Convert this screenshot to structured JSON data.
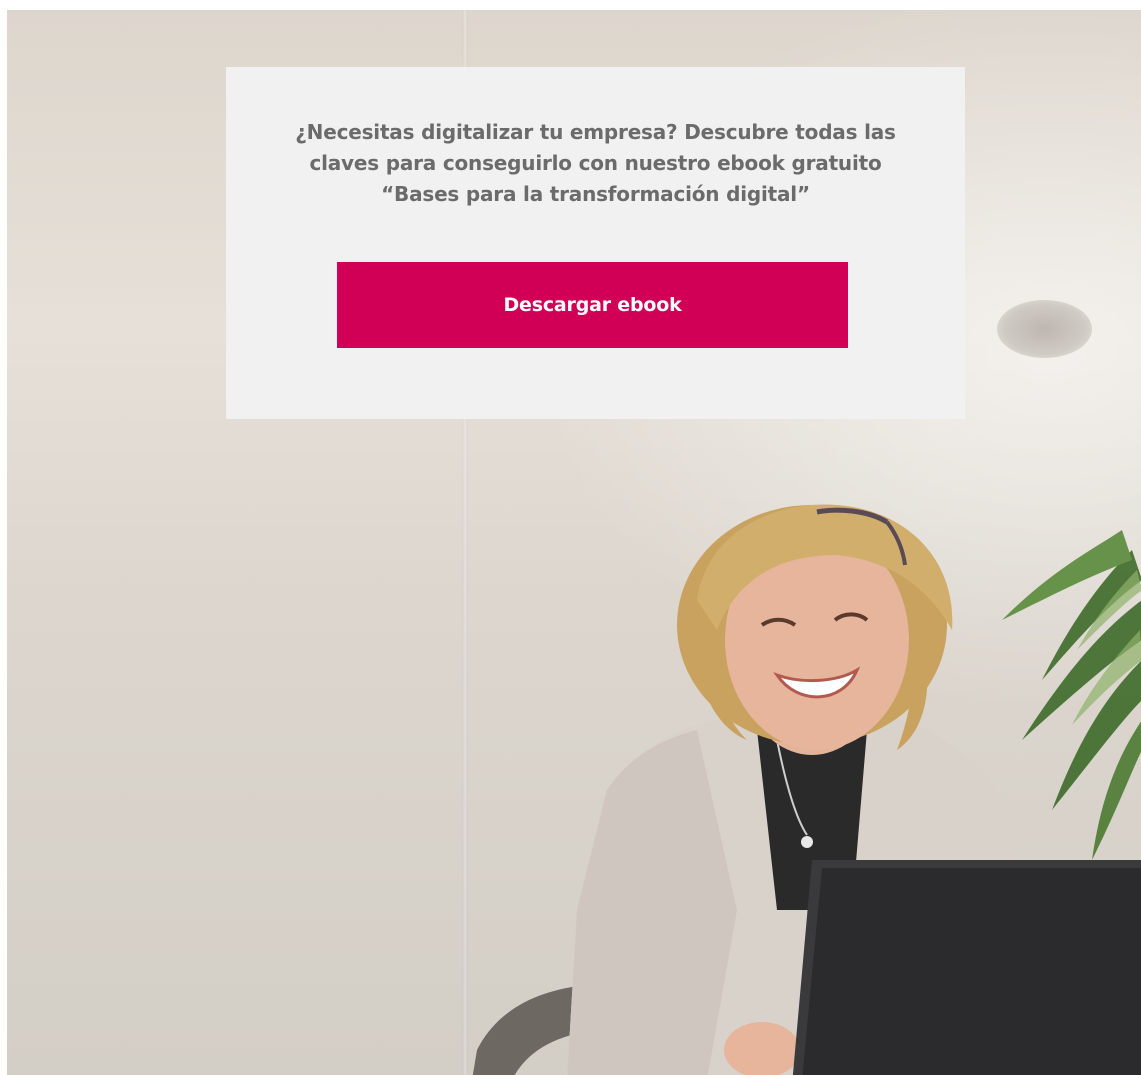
{
  "promo": {
    "text_lines": [
      "¿Necesitas digitalizar tu empresa? Descubre todas las",
      "claves para conseguirlo con  nuestro ebook gratuito",
      "“Bases para la transformación digital”"
    ],
    "button_label": "Descargar ebook"
  },
  "colors": {
    "card_background": "#f0f1f0",
    "text": "#6b6b6b",
    "accent": "#d10056",
    "button_text": "#ffffff"
  },
  "hero_image": {
    "subject": "smiling-woman-with-laptop"
  }
}
